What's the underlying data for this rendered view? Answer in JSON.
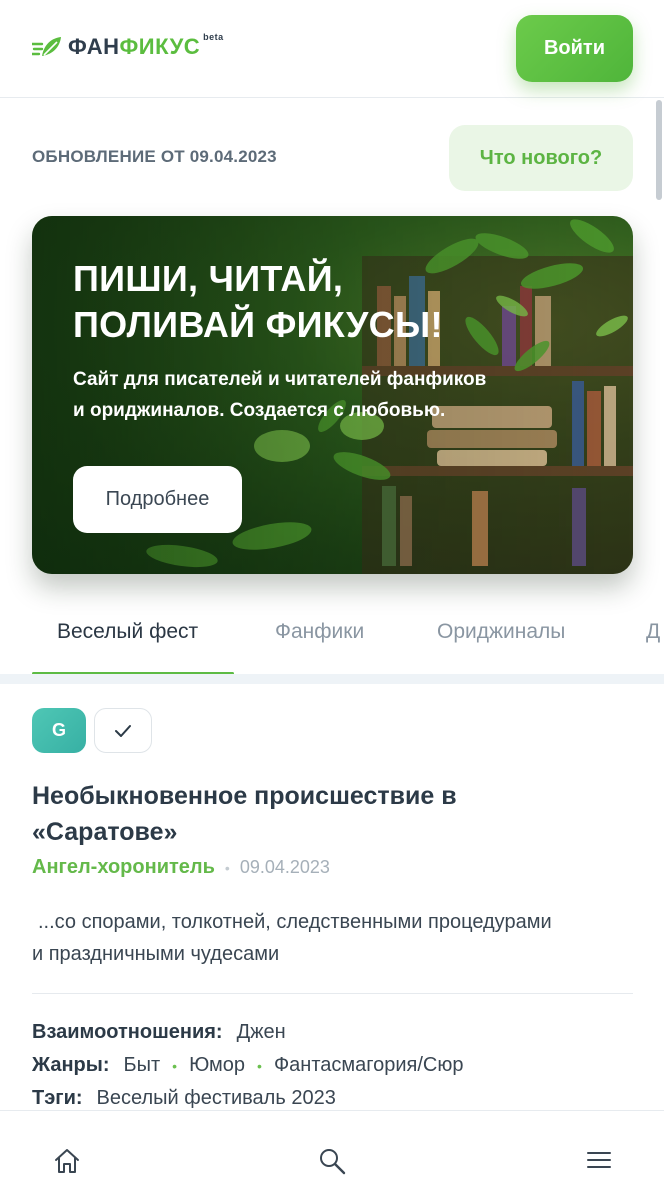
{
  "header": {
    "logo_part1": "ФАН",
    "logo_part2": "ФИКУС",
    "logo_beta": "beta",
    "login_label": "Войти",
    "brand_green": "#5bbd3f"
  },
  "update": {
    "text": "ОБНОВЛЕНИЕ ОТ 09.04.2023",
    "whats_new_label": "Что нового?"
  },
  "banner": {
    "title_line1": "ПИШИ, ЧИТАЙ,",
    "title_line2": "ПОЛИВАЙ ФИКУСЫ!",
    "subtitle_line1": "Сайт для писателей и читателей фанфиков",
    "subtitle_line2": "и ориджиналов. Создается с любовью.",
    "button_label": "Подробнее"
  },
  "tabs": [
    {
      "label": "Веселый фест",
      "active": true
    },
    {
      "label": "Фанфики",
      "active": false
    },
    {
      "label": "Ориджиналы",
      "active": false
    },
    {
      "label": "Д",
      "active": false
    }
  ],
  "card": {
    "rating": "G",
    "status_icon": "check-icon",
    "title_line1": "Необыкновенное происшествие в",
    "title_line2": "«Саратове»",
    "author": "Ангел-хоронитель",
    "date": "09.04.2023",
    "summary_line1": "...со спорами, толкотней, следственными процедурами",
    "summary_line2": "и праздничными чудесами",
    "relations_label": "Взаимоотношения:",
    "relations_value": "Джен",
    "genres_label": "Жанры:",
    "genres": [
      "Быт",
      "Юмор",
      "Фантасмагория/Сюр"
    ],
    "tags_label": "Тэги:",
    "tags_value": "Веселый фестиваль 2023"
  },
  "bottom_nav": {
    "items": [
      "home-icon",
      "search-icon",
      "menu-icon"
    ]
  }
}
